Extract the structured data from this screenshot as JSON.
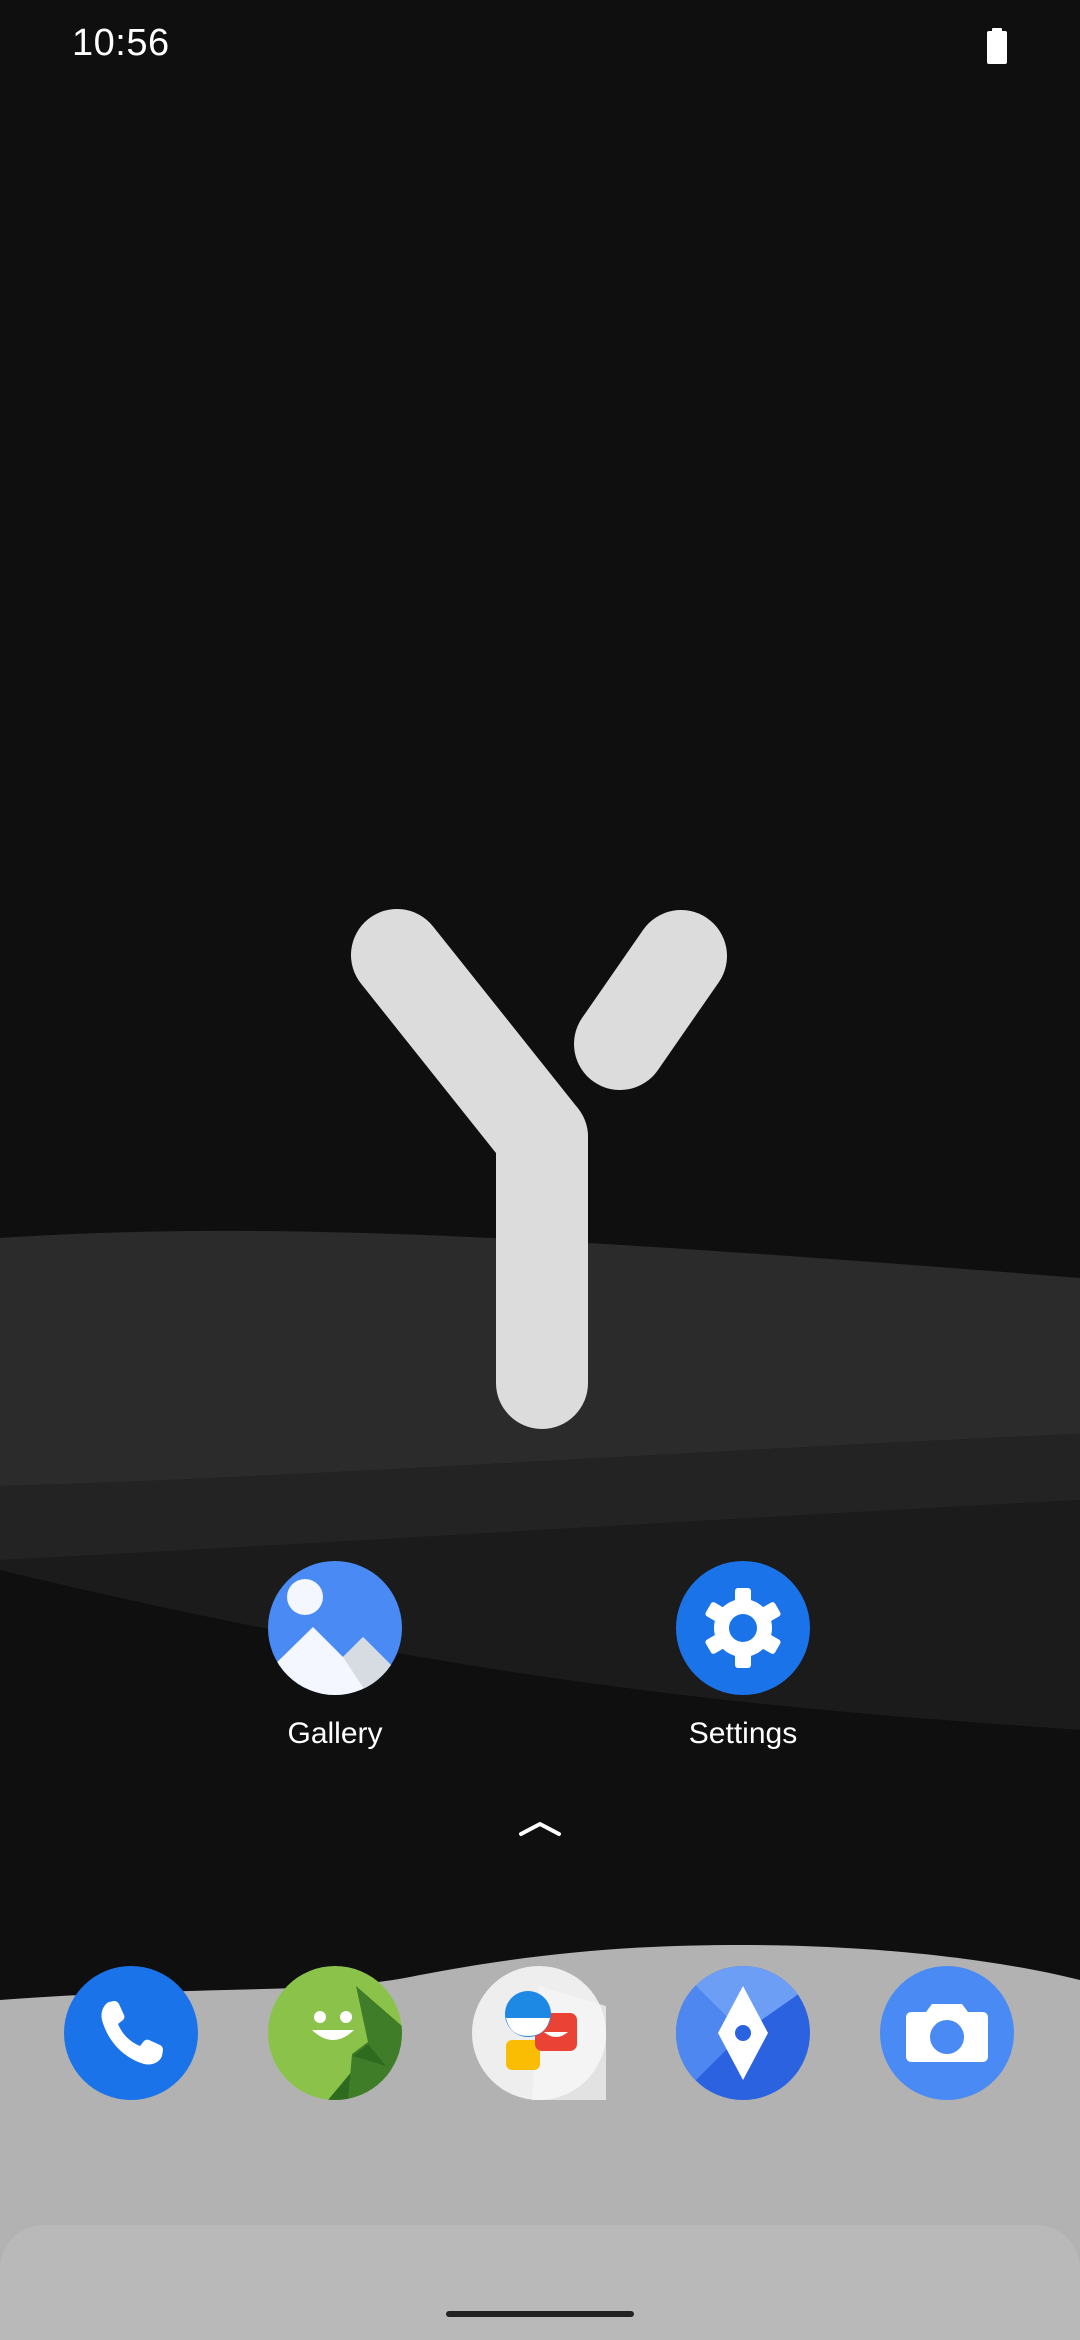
{
  "status_bar": {
    "time": "10:56",
    "battery_icon": "battery-full-icon"
  },
  "wallpaper": {
    "logo_icon": "y-logo-icon"
  },
  "home_apps": [
    {
      "label": "Gallery",
      "icon": "gallery-icon"
    },
    {
      "label": "Settings",
      "icon": "settings-gear-icon"
    }
  ],
  "app_drawer": {
    "icon": "chevron-up-icon"
  },
  "dock": [
    {
      "icon": "phone-icon"
    },
    {
      "icon": "messaging-icon"
    },
    {
      "icon": "chat-icon"
    },
    {
      "icon": "maps-icon"
    },
    {
      "icon": "camera-icon"
    }
  ],
  "colors": {
    "background": "#0f0f10",
    "accent_blue": "#1a73e8",
    "dock_grey": "#b3b3b3"
  }
}
